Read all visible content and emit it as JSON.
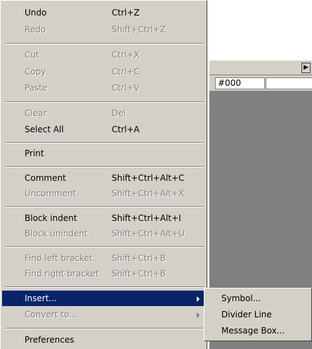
{
  "background": {
    "color_value": "#000"
  },
  "menu": {
    "items": [
      {
        "label": "Undo",
        "shortcut": "Ctrl+Z"
      },
      {
        "label": "Redo",
        "shortcut": "Shift+Ctrl+Z"
      },
      {
        "label": "Cut",
        "shortcut": "Ctrl+X"
      },
      {
        "label": "Copy",
        "shortcut": "Ctrl+C"
      },
      {
        "label": "Paste",
        "shortcut": "Ctrl+V"
      },
      {
        "label": "Clear",
        "shortcut": "Del"
      },
      {
        "label": "Select All",
        "shortcut": "Ctrl+A"
      },
      {
        "label": "Print",
        "shortcut": ""
      },
      {
        "label": "Comment",
        "shortcut": "Shift+Ctrl+Alt+C"
      },
      {
        "label": "Uncomment",
        "shortcut": "Shift+Ctrl+Alt+X"
      },
      {
        "label": "Block indent",
        "shortcut": "Shift+Ctrl+Alt+I"
      },
      {
        "label": "Block unindent",
        "shortcut": "Shift+Ctrl+Alt+U"
      },
      {
        "label": "Find left bracket",
        "shortcut": "Shift+Ctrl+B"
      },
      {
        "label": "Find right bracket",
        "shortcut": "Shift+Ctrl+B"
      },
      {
        "label": "Insert...",
        "shortcut": ""
      },
      {
        "label": "Convert to...",
        "shortcut": ""
      },
      {
        "label": "Preferences",
        "shortcut": ""
      }
    ]
  },
  "submenu": {
    "items": [
      {
        "label": "Symbol..."
      },
      {
        "label": "Divider Line"
      },
      {
        "label": "Message Box..."
      }
    ]
  },
  "colors": {
    "menu_bg": "#d4d0c8",
    "highlight": "#0a246a",
    "disabled_text": "#808080"
  }
}
